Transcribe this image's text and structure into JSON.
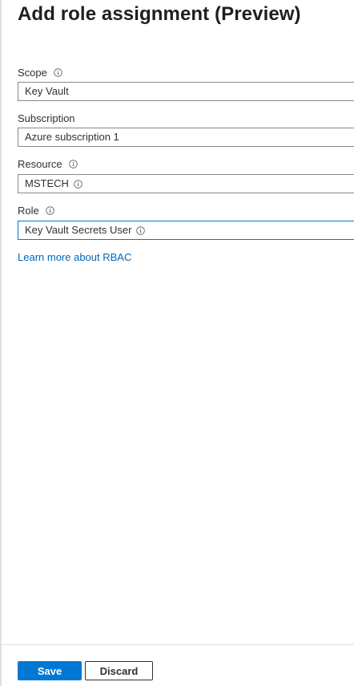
{
  "panel": {
    "title": "Add role assignment (Preview)"
  },
  "fields": {
    "scope": {
      "label": "Scope",
      "value": "Key Vault"
    },
    "subscription": {
      "label": "Subscription",
      "value": "Azure subscription 1"
    },
    "resource": {
      "label": "Resource",
      "value": "MSTECH"
    },
    "role": {
      "label": "Role",
      "value": "Key Vault Secrets User"
    }
  },
  "links": {
    "rbac": "Learn more about RBAC"
  },
  "footer": {
    "save_label": "Save",
    "discard_label": "Discard"
  },
  "colors": {
    "accent": "#0078d4",
    "link": "#0067b8",
    "border": "#8a8886",
    "text": "#323130"
  },
  "icons": {
    "info": "info-icon"
  }
}
